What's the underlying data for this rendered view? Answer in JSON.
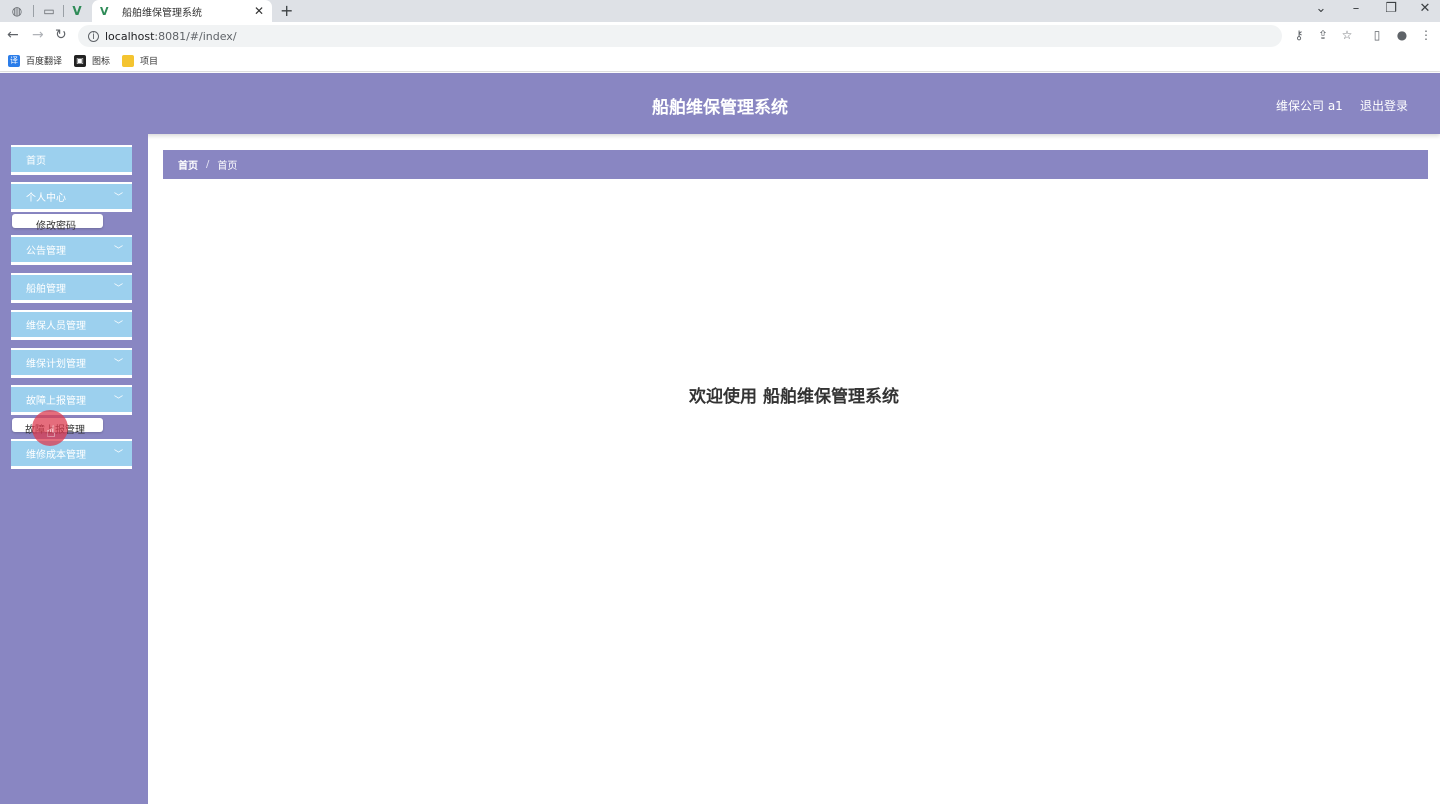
{
  "browser": {
    "tab_title": "船舶维保管理系统",
    "url_host": "localhost",
    "url_rest": ":8081/#/index/",
    "bookmarks": [
      {
        "label": "百度翻译",
        "icon": "translate-icon"
      },
      {
        "label": "图标",
        "icon": "image-icon"
      },
      {
        "label": "项目",
        "icon": "folder-icon"
      }
    ]
  },
  "header": {
    "title": "船舶维保管理系统",
    "user": "维保公司 a1",
    "logout": "退出登录"
  },
  "sidebar": {
    "items": [
      {
        "label": "首页"
      },
      {
        "label": "个人中心",
        "sub": "修改密码"
      },
      {
        "label": "公告管理"
      },
      {
        "label": "船舶管理"
      },
      {
        "label": "维保人员管理"
      },
      {
        "label": "维保计划管理"
      },
      {
        "label": "故障上报管理",
        "sub": "故障上报管理"
      },
      {
        "label": "维修成本管理"
      }
    ]
  },
  "breadcrumb": [
    "首页",
    "首页"
  ],
  "main": {
    "welcome": "欢迎使用 船舶维保管理系统"
  },
  "colors": {
    "primary": "#8986c2",
    "menu": "#9cd0ee"
  }
}
